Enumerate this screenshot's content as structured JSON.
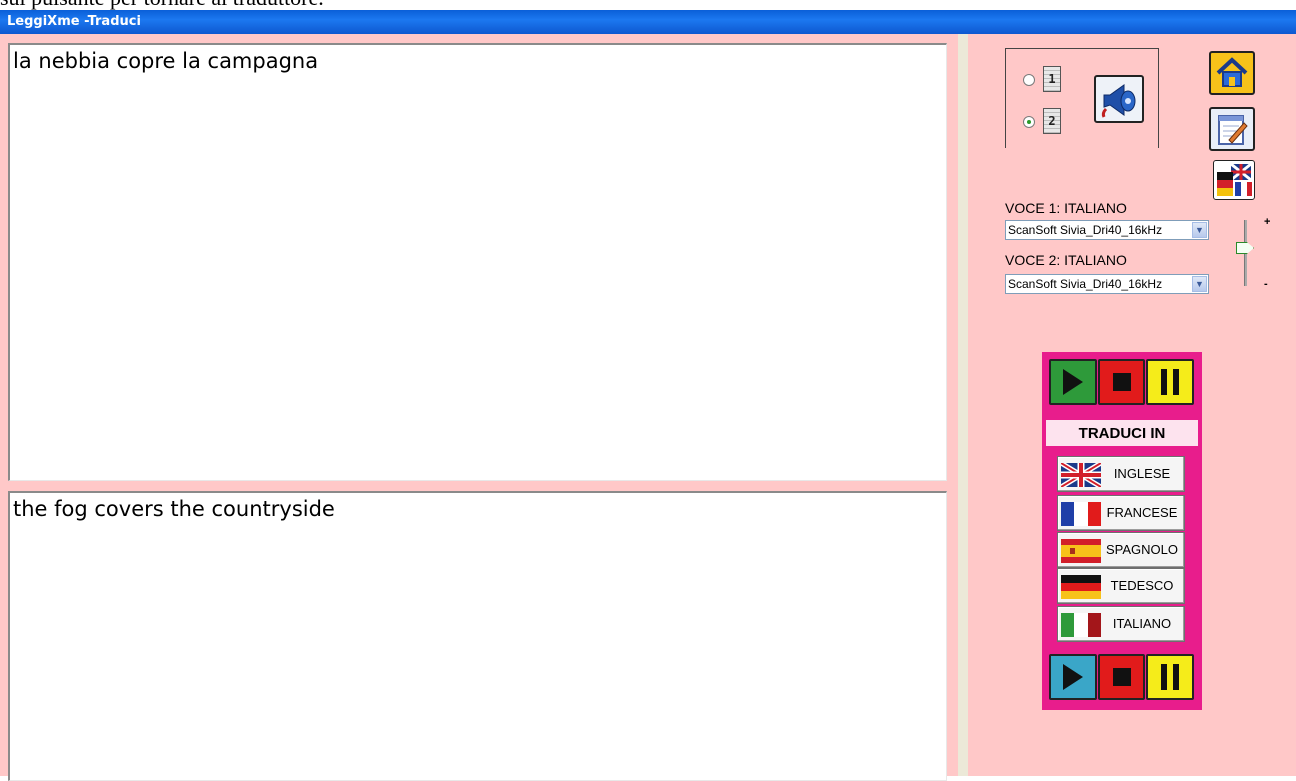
{
  "doc_fragment": "sul pulsante per tornare al traduttore.",
  "window": {
    "title": "LeggiXme -Traduci"
  },
  "source_text": "la nebbia copre la campagna",
  "translated_text": "the fog covers the countryside",
  "voice_selector": {
    "radio_1_label": "1",
    "radio_2_label": "2",
    "selected": 2
  },
  "voices": {
    "voice1_label": "VOCE 1:  ITALIANO",
    "voice1_value": "ScanSoft Sivia_Dri40_16kHz",
    "voice2_label": "VOCE 2:  ITALIANO",
    "voice2_value": "ScanSoft Sivia_Dri40_16kHz"
  },
  "volume": {
    "plus": "+",
    "minus": "-"
  },
  "translate_panel": {
    "title": "TRADUCI IN",
    "languages": [
      {
        "label": "INGLESE",
        "flag": "uk-flag-icon"
      },
      {
        "label": "FRANCESE",
        "flag": "france-flag-icon"
      },
      {
        "label": "SPAGNOLO",
        "flag": "spain-flag-icon"
      },
      {
        "label": "TEDESCO",
        "flag": "germany-flag-icon"
      },
      {
        "label": "ITALIANO",
        "flag": "italy-flag-icon"
      }
    ]
  },
  "icons": {
    "home": "home-icon",
    "notepad": "notepad-icon",
    "language_flags": "language-flags-icon",
    "speaker": "speaker-horn-icon"
  },
  "colors": {
    "background": "#ffc8c8",
    "panel": "#e81d8c",
    "titlebar": "#0a5fd8"
  }
}
